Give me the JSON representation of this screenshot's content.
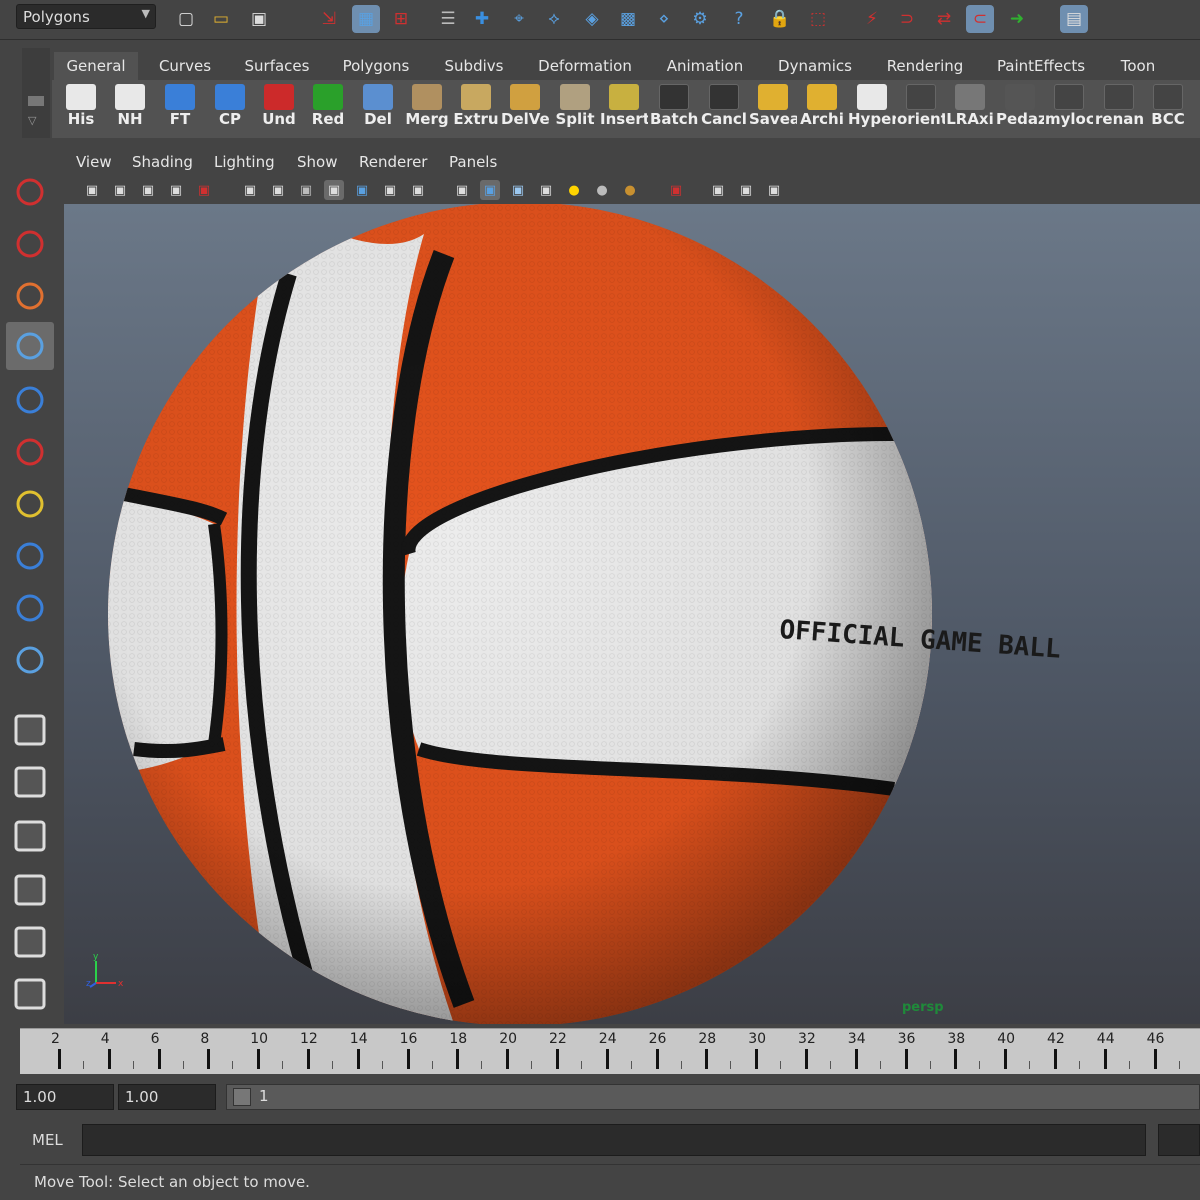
{
  "status_line": {
    "menu_set": "Polygons",
    "icons": [
      "new-scene-icon",
      "open-scene-icon",
      "save-scene-icon",
      "select-hierarchy-icon",
      "select-object-icon",
      "select-component-icon",
      "filter-icon",
      "snap-grid-icon",
      "snap-curve-icon",
      "snap-point-icon",
      "snap-view-plane-icon",
      "snap-live-icon",
      "construction-history-icon",
      "render-icon",
      "ipr-render-icon",
      "render-settings-icon",
      "help-icon",
      "lock-icon",
      "select-tool-icon",
      "magnet-icon",
      "input-ops-icon",
      "output-ops-icon",
      "channel-box-icon"
    ]
  },
  "shelf": {
    "tabs": [
      "General",
      "Curves",
      "Surfaces",
      "Polygons",
      "Subdivs",
      "Deformation",
      "Animation",
      "Dynamics",
      "Rendering",
      "PaintEffects",
      "Toon"
    ],
    "active_tab": 0,
    "buttons": [
      {
        "label": "His",
        "color": "#e8e8e8"
      },
      {
        "label": "NH",
        "color": "#e8e8e8"
      },
      {
        "label": "FT",
        "color": "#3a7fd8"
      },
      {
        "label": "CP",
        "color": "#3a7fd8"
      },
      {
        "label": "Und",
        "color": "#cc2a2a"
      },
      {
        "label": "Red",
        "color": "#2aa02a"
      },
      {
        "label": "Del",
        "color": "#5b8fd0"
      },
      {
        "label": "Merg",
        "color": "#b09060"
      },
      {
        "label": "Extru",
        "color": "#c8a860"
      },
      {
        "label": "DelVe",
        "color": "#d0a040"
      },
      {
        "label": "Split",
        "color": "#b0a080"
      },
      {
        "label": "Insert",
        "color": "#c8b040"
      },
      {
        "label": "Batch",
        "color": "#333333"
      },
      {
        "label": "Cancl",
        "color": "#333333"
      },
      {
        "label": "Savea",
        "color": "#e0b030"
      },
      {
        "label": "Archi",
        "color": "#e0b030"
      },
      {
        "label": "Hyper",
        "color": "#e8e8e8"
      },
      {
        "label": "orient",
        "color": "#444444"
      },
      {
        "label": "LRAxi",
        "color": "#777777"
      },
      {
        "label": "Pedaz",
        "color": "#555555"
      },
      {
        "label": "myloc",
        "color": "#444444"
      },
      {
        "label": "renan",
        "color": "#444444"
      },
      {
        "label": "BCC",
        "color": "#444444"
      }
    ]
  },
  "toolbox": {
    "tools": [
      "select-tool-icon",
      "lasso-tool-icon",
      "paint-select-tool-icon",
      "move-tool-icon",
      "rotate-tool-icon",
      "scale-tool-icon",
      "universal-manipulator-icon",
      "soft-mod-icon",
      "show-manipulator-icon",
      "lattice-icon",
      "single-perspective-layout-icon",
      "four-view-layout-icon",
      "outliner-layout-icon",
      "graph-editor-layout-icon",
      "hypershade-layout-icon",
      "maya-logo-icon"
    ],
    "selected": 3
  },
  "panel": {
    "menus": [
      "View",
      "Shading",
      "Lighting",
      "Show",
      "Renderer",
      "Panels"
    ],
    "camera_name": "persp",
    "ball_text": "OFFICIAL GAME BALL",
    "colors": {
      "orange": "#e4531d",
      "white": "#ececec",
      "seam": "#151515"
    }
  },
  "time_slider": {
    "labels": [
      "2",
      "4",
      "6",
      "8",
      "10",
      "12",
      "14",
      "16",
      "18",
      "20",
      "22",
      "24",
      "26",
      "28",
      "30",
      "32",
      "34",
      "36",
      "38",
      "40",
      "42",
      "44",
      "46"
    ]
  },
  "range_slider": {
    "start": "1.00",
    "playback_start": "1.00",
    "current": "1"
  },
  "command_line": {
    "label": "MEL"
  },
  "help_line": {
    "text": "Move Tool: Select an object to move."
  }
}
